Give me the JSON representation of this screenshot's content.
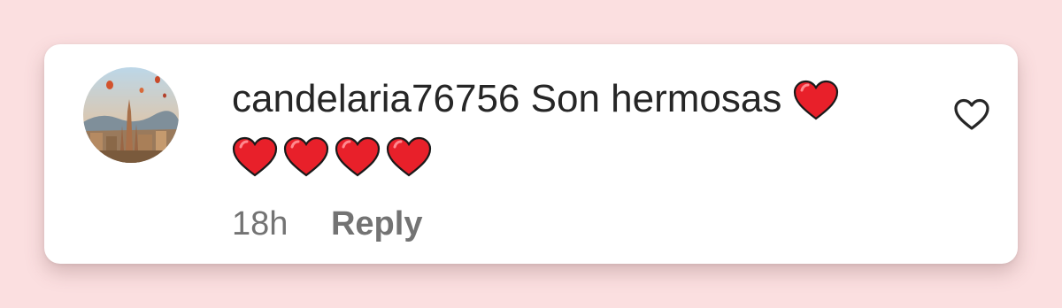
{
  "comment": {
    "username": "candelaria76756",
    "text": "Son hermosas",
    "emoji_count": 5,
    "emoji_name": "red-heart-emoji"
  },
  "meta": {
    "time": "18h",
    "reply_label": "Reply"
  },
  "icons": {
    "like": "heart-outline-icon",
    "avatar": "avatar-landscape-photo"
  },
  "colors": {
    "background": "#fbdfe0",
    "card": "#ffffff",
    "text": "#262626",
    "muted": "#737373",
    "heart": "#e8202a"
  }
}
